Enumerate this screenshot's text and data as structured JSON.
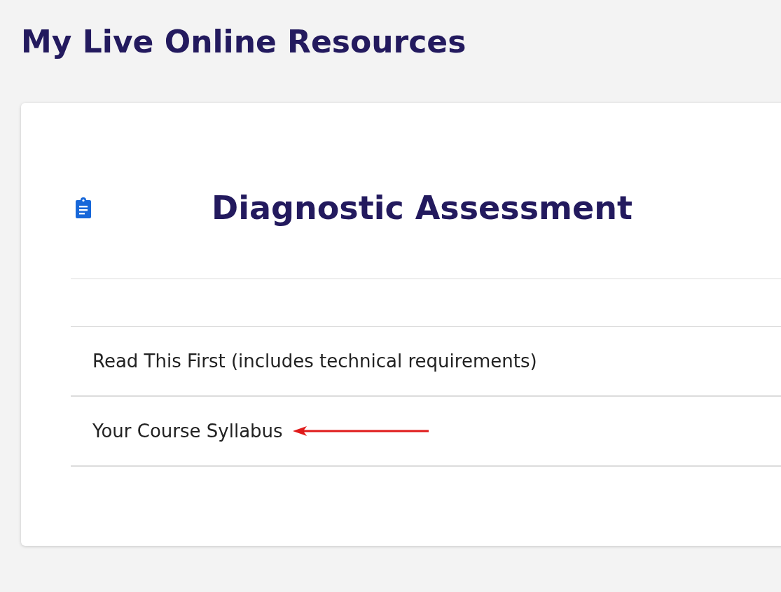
{
  "page_title": "My Live Online Resources",
  "card": {
    "heading": "Diagnostic Assessment",
    "items": [
      {
        "label": "Read This First (includes technical requirements)",
        "annotated": false
      },
      {
        "label": "Your Course Syllabus",
        "annotated": true
      }
    ]
  }
}
